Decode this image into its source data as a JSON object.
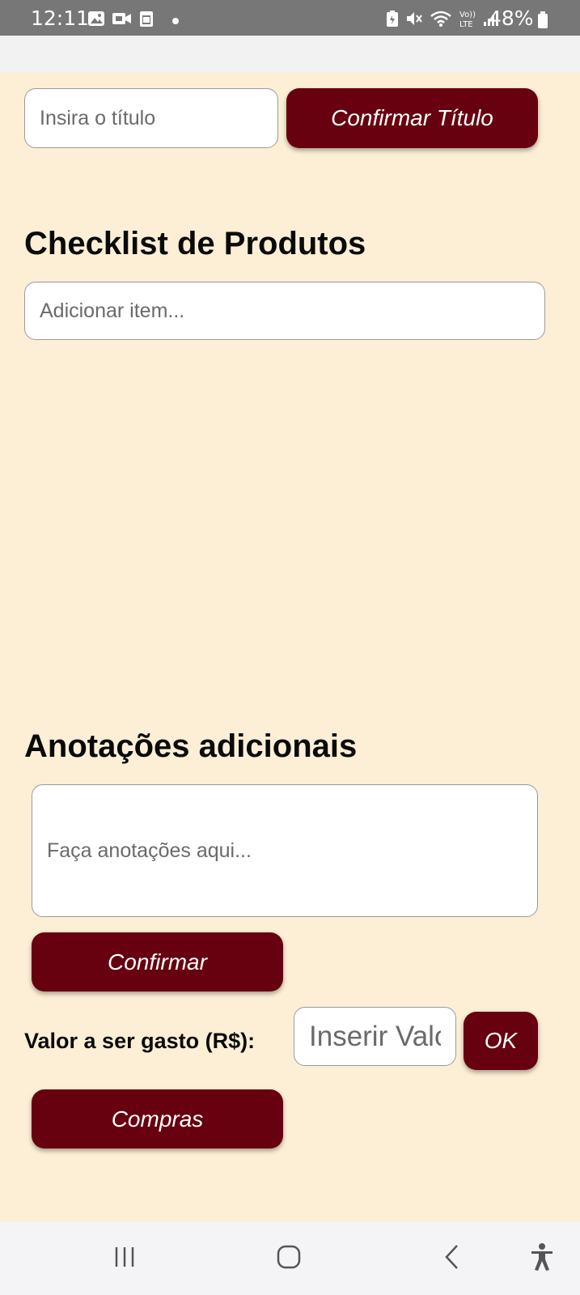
{
  "status_bar": {
    "time": "12:11",
    "battery": "48%",
    "icons": [
      "gallery-icon",
      "video-call-icon",
      "clipboard-icon",
      "notification-dot-icon",
      "battery-saver-icon",
      "mute-icon",
      "wifi-icon",
      "volte-icon",
      "signal-icon",
      "battery-icon"
    ]
  },
  "title_section": {
    "title_placeholder": "Insira o título",
    "confirm_title_label": "Confirmar Título"
  },
  "checklist": {
    "heading": "Checklist de Produtos",
    "add_item_placeholder": "Adicionar item..."
  },
  "notes": {
    "heading": "Anotações adicionais",
    "notes_placeholder": "Faça anotações aqui...",
    "confirm_label": "Confirmar"
  },
  "budget": {
    "label": "Valor a ser gasto (R$):",
    "value_placeholder": "Inserir Valor",
    "ok_label": "OK"
  },
  "shopping": {
    "button_label": "Compras"
  },
  "nav_bar": {
    "buttons": [
      "recent-apps-icon",
      "home-icon",
      "back-icon",
      "accessibility-icon"
    ]
  },
  "colors": {
    "background": "#fdefd6",
    "accent": "#67000f",
    "status_bar": "#777777"
  }
}
